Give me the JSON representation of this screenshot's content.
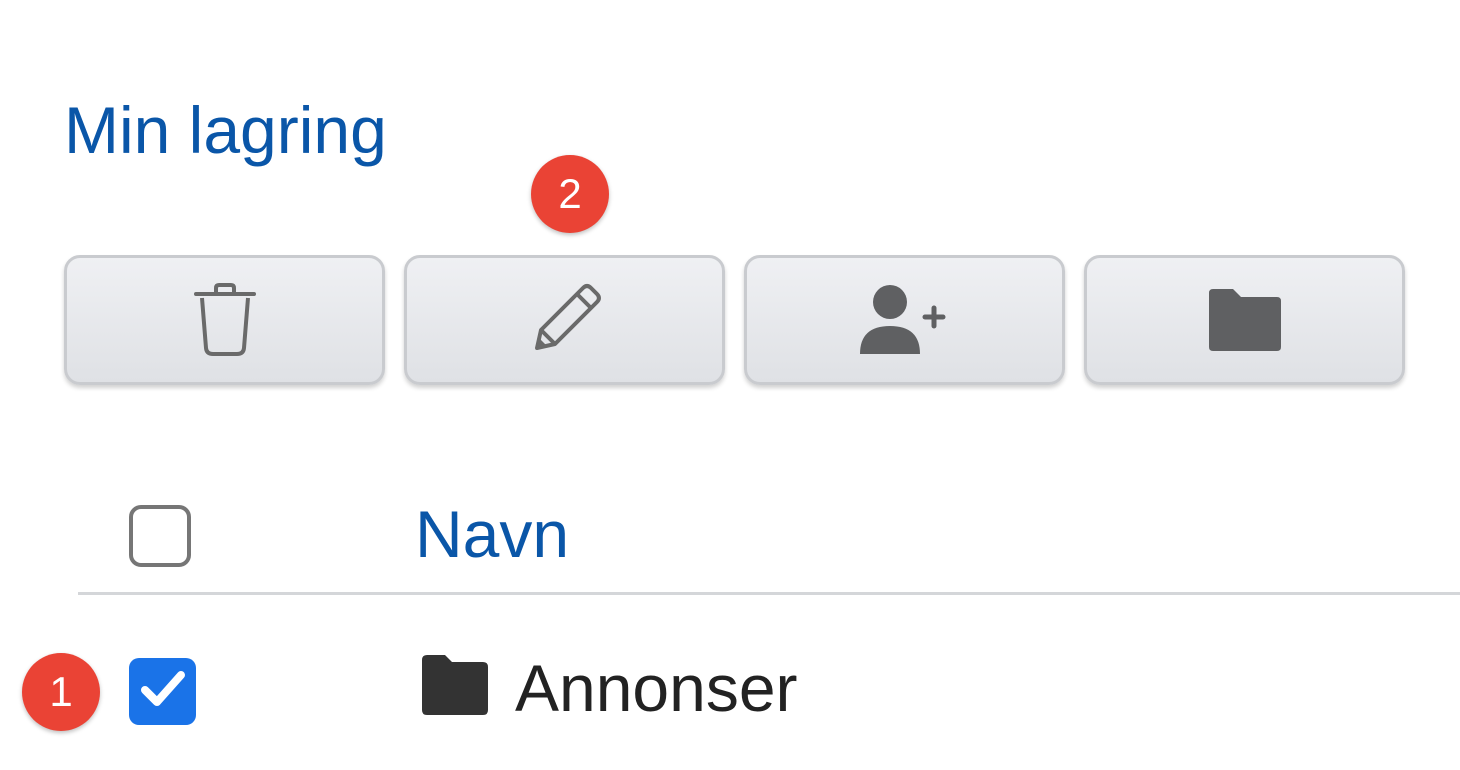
{
  "page": {
    "title": "Min lagring"
  },
  "badges": {
    "first": "1",
    "second": "2"
  },
  "toolbar": {
    "buttons": [
      {
        "icon": "trash-icon"
      },
      {
        "icon": "pencil-icon"
      },
      {
        "icon": "add-user-icon"
      },
      {
        "icon": "folder-icon"
      }
    ]
  },
  "table": {
    "header": {
      "name_label": "Navn",
      "select_all_checked": false
    },
    "rows": [
      {
        "name": "Annonser",
        "type_icon": "folder-icon",
        "selected": true
      }
    ]
  },
  "colors": {
    "accent": "#0a56a8",
    "badge": "#ea4335",
    "checkbox_checked": "#1a73e8"
  }
}
